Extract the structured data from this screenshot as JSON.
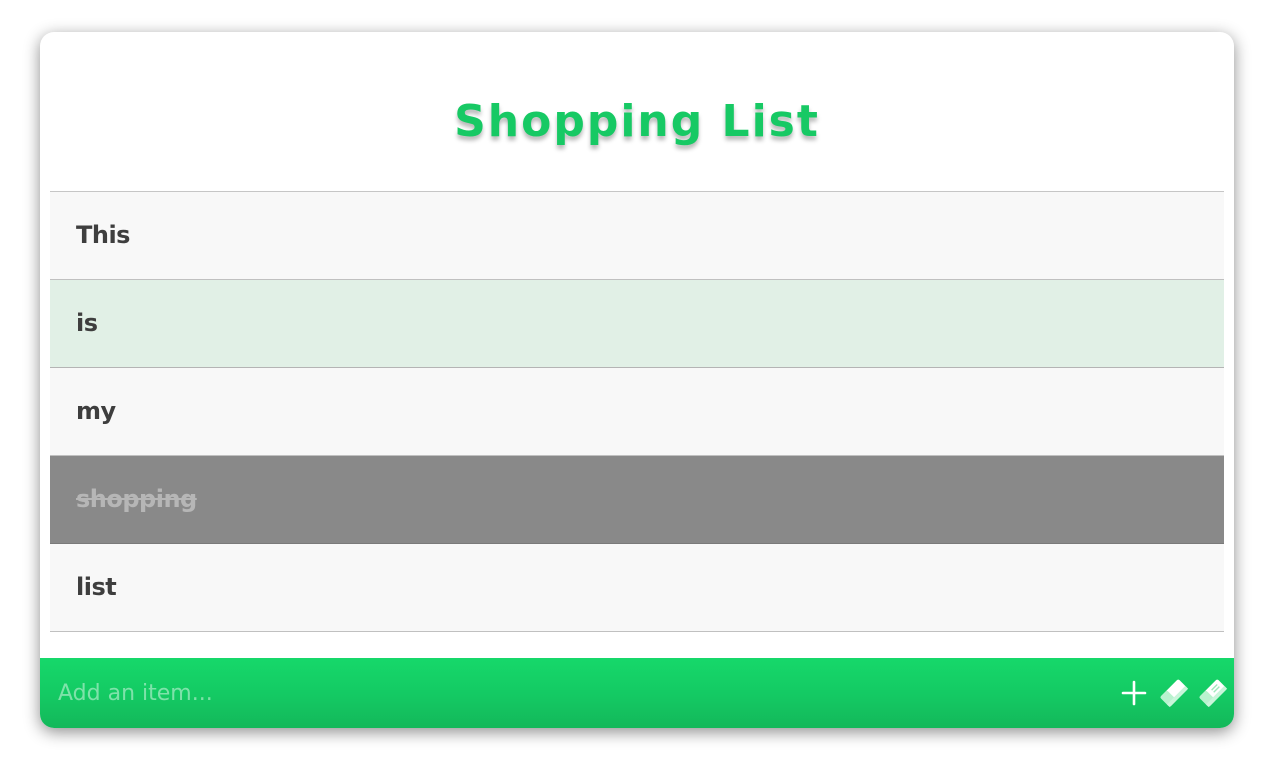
{
  "header": {
    "title": "Shopping List"
  },
  "items": [
    {
      "label": "This",
      "state": "normal"
    },
    {
      "label": "is",
      "state": "hover"
    },
    {
      "label": "my",
      "state": "normal"
    },
    {
      "label": "shopping",
      "state": "done"
    },
    {
      "label": "list",
      "state": "normal"
    }
  ],
  "footer": {
    "input_value": "",
    "input_placeholder": "Add an item...",
    "icons": [
      "plus-icon",
      "eraser-icon",
      "eraser-icon"
    ]
  },
  "colors": {
    "accent": "#17c964",
    "hover_row": "#e1f0e6",
    "done_row": "#898989",
    "row": "#f8f8f8"
  }
}
